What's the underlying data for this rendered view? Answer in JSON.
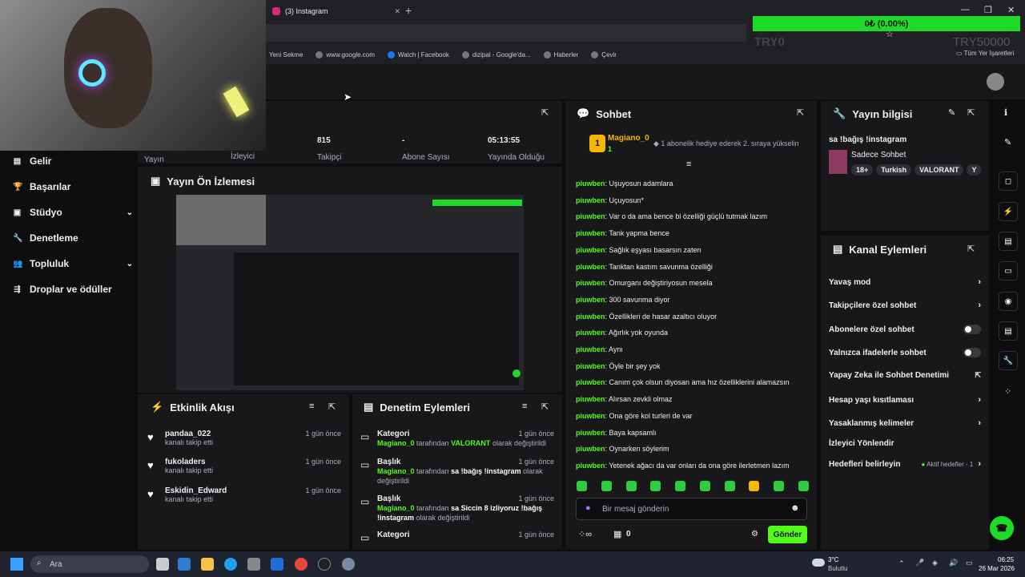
{
  "browser": {
    "tab_title": "(3) Instagram",
    "bookmarks": [
      "Yeni Sekme",
      "www.google.com",
      "Watch | Facebook",
      "dizipal - Google'da...",
      "Haberler",
      "Çevir"
    ],
    "all_bookmarks": "Tüm Yer İşaretleri"
  },
  "overlay": {
    "goal_progress": "0₺ (0.00%)",
    "goal_fraction": 0.0,
    "goal_left": "TRY0",
    "goal_right": "TRY50000"
  },
  "sidebar": {
    "items": [
      {
        "label": "Gelir",
        "icon": "revenue-icon"
      },
      {
        "label": "Başarılar",
        "icon": "trophy-icon"
      },
      {
        "label": "Stüdyo",
        "icon": "studio-icon",
        "chevron": true
      },
      {
        "label": "Denetleme",
        "icon": "wrench-icon"
      },
      {
        "label": "Topluluk",
        "icon": "community-icon",
        "chevron": true
      },
      {
        "label": "Droplar ve ödüller",
        "icon": "drops-icon"
      }
    ]
  },
  "stats": {
    "yayin_label": "Yayın",
    "izleyici_label": "İzleyici",
    "takipci_value": "815",
    "takipci_label": "Takipçi",
    "abone_value": "-",
    "abone_label": "Abone Sayısı",
    "sure_value": "05:13:55",
    "sure_label": "Yayında Olduğu"
  },
  "preview": {
    "title": "Yayın Ön İzlemesi"
  },
  "activity": {
    "title": "Etkinlik Akışı",
    "items": [
      {
        "name": "pandaa_022",
        "sub": "kanalı takip etti",
        "time": "1 gün önce"
      },
      {
        "name": "fukoladers",
        "sub": "kanalı takip etti",
        "time": "1 gün önce"
      },
      {
        "name": "Eskidin_Edward",
        "sub": "kanalı takip etti",
        "time": "1 gün önce"
      }
    ]
  },
  "moderation": {
    "title": "Denetim Eylemleri",
    "items": [
      {
        "title": "Kategori",
        "time": "1 gün önce",
        "user": "Magiano_0",
        "pre": "tarafından",
        "value": "VALORANT",
        "post": "olarak değiştirildi"
      },
      {
        "title": "Başlık",
        "time": "1 gün önce",
        "user": "Magiano_0",
        "pre": "tarafından",
        "value": "sa !bağış !instagram",
        "post": "olarak değiştirildi"
      },
      {
        "title": "Başlık",
        "time": "1 gün önce",
        "user": "Magiano_0",
        "pre": "tarafından",
        "value": "sa Siccin 8 izliyoruz !bağış !instagram",
        "post": "olarak değiştirildi"
      },
      {
        "title": "Kategori",
        "time": "1 gün önce"
      }
    ]
  },
  "chat": {
    "title": "Sohbet",
    "pinned_user": "Magiano_0",
    "pinned_badge": "1",
    "pinned_rank": "1",
    "pinned_text": "1 abonelik hediye ederek 2. sıraya yükselin",
    "messages": [
      {
        "user": "piuwben",
        "text": "Uşuyosun adamlara"
      },
      {
        "user": "piuwben",
        "text": "Uçuyosun*"
      },
      {
        "user": "piuwben",
        "text": "Var o da ama bence bi özelliği güçlü tutmak lazım"
      },
      {
        "user": "piuwben",
        "text": "Tank yapma bence"
      },
      {
        "user": "piuwben",
        "text": "Sağlık eşyası basarsın zaten"
      },
      {
        "user": "piuwben",
        "text": "Tanktan kastım savunma özelliği"
      },
      {
        "user": "piuwben",
        "text": "Omurganı değiştiriyosun mesela"
      },
      {
        "user": "piuwben",
        "text": "300 savunma diyor"
      },
      {
        "user": "piuwben",
        "text": "Özellikleri de hasar azaltıcı oluyor"
      },
      {
        "user": "piuwben",
        "text": "Ağırlık yok oyunda"
      },
      {
        "user": "piuwben",
        "text": "Aynı"
      },
      {
        "user": "piuwben",
        "text": "Öyle bir şey yok"
      },
      {
        "user": "piuwben",
        "text": "Canım çok olsun diyosan ama hız özelliklerini alamazsın"
      },
      {
        "user": "piuwben",
        "text": "Alırsan zevkli olmaz"
      },
      {
        "user": "piuwben",
        "text": "Ona göre kol turleri de var"
      },
      {
        "user": "piuwben",
        "text": "Baya kapsamlı"
      },
      {
        "user": "piuwben",
        "text": "Oynarken söylerim"
      },
      {
        "user": "piuwben",
        "text": "Yetenek ağacı da var onları da ona göre ilerletmen lazım"
      }
    ],
    "input_placeholder": "Bir mesaj gönderin",
    "points": "0",
    "send_label": "Gönder"
  },
  "streaminfo": {
    "title": "Yayın bilgisi",
    "stream_title": "sa !bağış !instagram",
    "category": "Sadece Sohbet",
    "tags": [
      "18+",
      "Turkish",
      "VALORANT",
      "Y"
    ]
  },
  "channelactions": {
    "title": "Kanal Eylemleri",
    "items": [
      {
        "label": "Yavaş mod",
        "control": "chevron"
      },
      {
        "label": "Takipçilere özel sohbet",
        "control": "chevron"
      },
      {
        "label": "Abonelere özel sohbet",
        "control": "toggle"
      },
      {
        "label": "Yalnızca ifadelerle sohbet",
        "control": "toggle"
      },
      {
        "label": "Yapay Zeka ile Sohbet Denetimi",
        "control": "external"
      },
      {
        "label": "Hesap yaşı kısıtlaması",
        "control": "chevron"
      },
      {
        "label": "Yasaklanmış kelimeler",
        "control": "chevron"
      },
      {
        "label": "İzleyici Yönlendir",
        "control": "none"
      },
      {
        "label": "Hedefleri belirleyin",
        "control": "chevron",
        "extra": "Aktif hedefler - 1"
      }
    ]
  },
  "taskbar": {
    "search": "Ara",
    "weather_temp": "3°C",
    "weather_desc": "Bulutlu",
    "time": "06:25",
    "date": "26 Mar 2026"
  },
  "colors": {
    "accent": "#53fc18",
    "panel": "#18181b",
    "bg": "#0e0e10"
  }
}
